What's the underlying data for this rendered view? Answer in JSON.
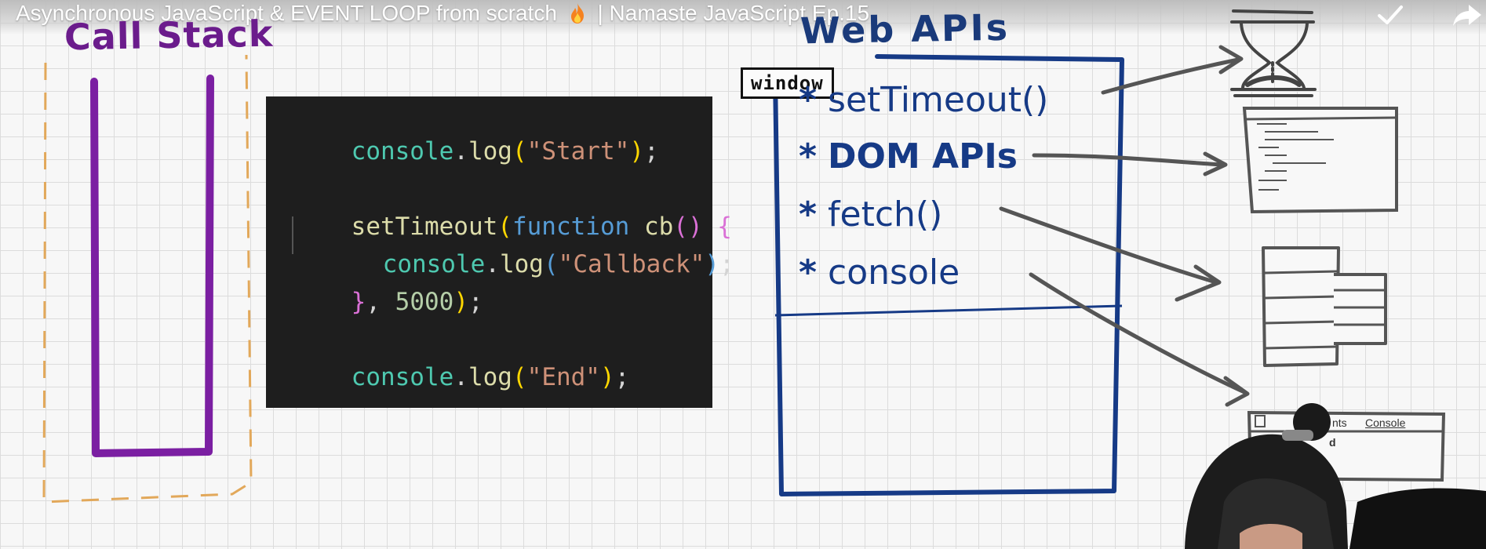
{
  "video": {
    "title": "Asynchronous JavaScript & EVENT LOOP from scratch",
    "title_suffix": "| Namaste JavaScript Ep.15"
  },
  "icons": {
    "fire": "fire-icon",
    "check": "check-icon",
    "share": "share-icon"
  },
  "call_stack": {
    "label": "Call Stack",
    "color": "#6b1c8c",
    "border_color": "#e2a85a"
  },
  "code": {
    "line1": {
      "obj": "console",
      "dot": ".",
      "fn": "log",
      "open": "(",
      "str": "\"Start\"",
      "close": ")",
      "end": ";"
    },
    "line2": {
      "fn": "setTimeout",
      "open": "(",
      "kw": "function",
      "name": " cb",
      "parens": "()",
      "brace": " {"
    },
    "line3": {
      "obj": "console",
      "dot": ".",
      "fn": "log",
      "open": "(",
      "str": "\"Callback\"",
      "close": ")",
      "end": ";"
    },
    "line4": {
      "brace": "}",
      "comma": ", ",
      "num": "5000",
      "close": ")",
      "end": ";"
    },
    "line5": {
      "obj": "console",
      "dot": ".",
      "fn": "log",
      "open": "(",
      "str": "\"End\"",
      "close": ")",
      "end": ";"
    }
  },
  "web_apis": {
    "title": "Web APIs",
    "window_label": "window",
    "items": [
      {
        "star": "*",
        "label": "setTimeout()"
      },
      {
        "star": "*",
        "label": "DOM APIs"
      },
      {
        "star": "*",
        "label": "fetch()"
      },
      {
        "star": "*",
        "label": "console"
      }
    ],
    "color": "#163a86"
  },
  "devtools": {
    "tab_partial": "nts",
    "tab_console": "Console",
    "partial_text": "d"
  }
}
